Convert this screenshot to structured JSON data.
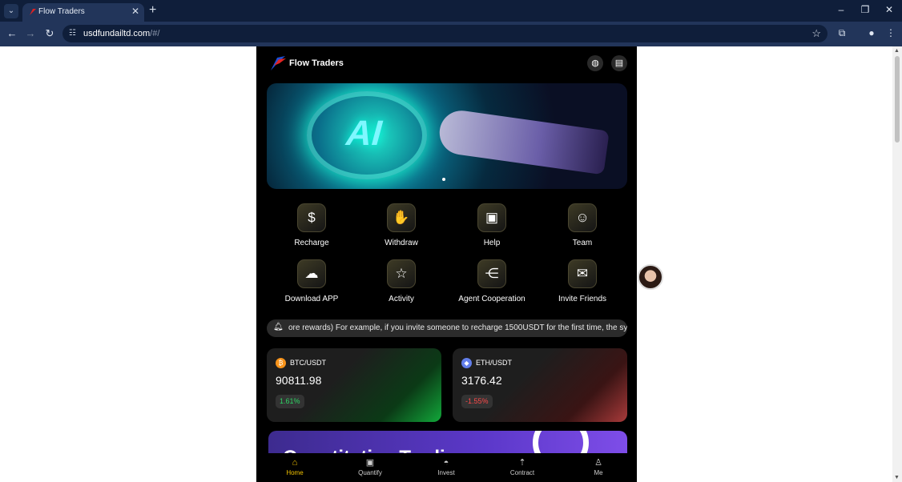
{
  "browser": {
    "tab_title": "Flow Traders",
    "url_host": "usdfundailtd.com",
    "url_path": "/#/"
  },
  "app": {
    "brand": "Flow Traders",
    "banner_text": "AI",
    "menu": [
      {
        "label": "Recharge",
        "icon": "dollar-circle-icon"
      },
      {
        "label": "Withdraw",
        "icon": "hand-coin-icon"
      },
      {
        "label": "Help",
        "icon": "book-icon"
      },
      {
        "label": "Team",
        "icon": "users-icon"
      },
      {
        "label": "Download APP",
        "icon": "cloud-download-icon"
      },
      {
        "label": "Activity",
        "icon": "bookmark-star-icon"
      },
      {
        "label": "Agent Cooperation",
        "icon": "share-nodes-icon"
      },
      {
        "label": "Invite Friends",
        "icon": "envelope-icon"
      }
    ],
    "notice": "ore rewards) For example, if you invite someone to recharge 1500USDT for the first time, the system",
    "tickers": [
      {
        "pair": "BTC/USDT",
        "price": "90811.98",
        "change": "1.61%",
        "direction": "up",
        "color": "#f7931a"
      },
      {
        "pair": "ETH/USDT",
        "price": "3176.42",
        "change": "-1.55%",
        "direction": "down",
        "color": "#627eea"
      }
    ],
    "promo_text": "Quantitative Trading",
    "nav": [
      {
        "label": "Home",
        "icon": "home-icon",
        "active": true
      },
      {
        "label": "Quantify",
        "icon": "quantify-icon",
        "active": false
      },
      {
        "label": "Invest",
        "icon": "invest-icon",
        "active": false
      },
      {
        "label": "Contract",
        "icon": "contract-icon",
        "active": false
      },
      {
        "label": "Me",
        "icon": "user-icon",
        "active": false
      }
    ]
  },
  "colors": {
    "accent": "#f2c200",
    "up": "#2ed664",
    "down": "#ff4a4a"
  }
}
